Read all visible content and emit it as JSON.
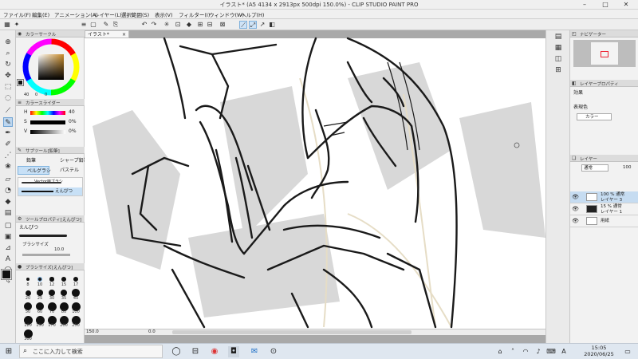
{
  "window": {
    "title": "イラスト* (A5 4134 x 2913px 500dpi 150.0%) - CLIP STUDIO PAINT PRO"
  },
  "menu": [
    "ファイル(F)",
    "編集(E)",
    "アニメーション(A)",
    "レイヤー(L)",
    "選択範囲(S)",
    "表示(V)",
    "フィルター(I)",
    "ウィンドウ(W)",
    "ヘルプ(H)"
  ],
  "doc_tab": {
    "label": "イラスト*",
    "close": "×"
  },
  "colors": {
    "accent": "#6fa3d4",
    "selected_bg": "#c6dcf1",
    "taskbar": "#dfe7f0",
    "canvas_bg": "#a9a9a9",
    "paper": "#ffffff"
  },
  "left_panel": {
    "color_circle_title": "カラーサークル",
    "color_slider_title": "カラースライダー",
    "hsv": [
      {
        "label": "H",
        "value": "40"
      },
      {
        "label": "S",
        "value": "0%"
      },
      {
        "label": "V",
        "value": "0%"
      }
    ],
    "color_circle_values": {
      "a": "40",
      "b": "0",
      "c": "0"
    },
    "subtool_title": "サブツール[鉛筆]",
    "subtools": [
      "鉛筆",
      "シャープ鉛筆",
      "ベルグラシ",
      "パステル"
    ],
    "brushes": [
      "Vector用ブラシ",
      "えんぴつ"
    ],
    "tool_property_title": "ツールプロパティ[えんぴつ]",
    "tool_property_name": "えんぴつ",
    "brush_size_label": "ブラシサイズ",
    "brush_size_value": "10.0",
    "brush_size_panel_title": "ブラシサイズ[えんぴつ]",
    "brush_sizes": [
      "8",
      "10",
      "12",
      "15",
      "17",
      "20",
      "25",
      "30",
      "35",
      "40",
      "50",
      "60",
      "70",
      "80",
      "100",
      "120",
      "150",
      "170",
      "200",
      "250",
      "300"
    ]
  },
  "right_panel": {
    "navigator_label": "ナビゲーター",
    "layer_property_label": "レイヤープロパティ",
    "effect_label": "効果",
    "expression_color_label": "表現色",
    "expression_color_value": "カラー",
    "layer_tab": "レイヤー",
    "blend_mode": "通常",
    "opacity": "100",
    "layers": [
      {
        "line1": "100 % 通常",
        "line2": "レイヤー 3"
      },
      {
        "line1": "15 % 通常",
        "line2": "レイヤー 1"
      },
      {
        "line1": "",
        "line2": "用紙"
      }
    ]
  },
  "status": {
    "zoom": "150.0",
    "rotation": "0.0"
  },
  "taskbar": {
    "search_placeholder": "ここに入力して検索",
    "time": "15:05",
    "date": "2020/06/25",
    "ime": "A"
  }
}
